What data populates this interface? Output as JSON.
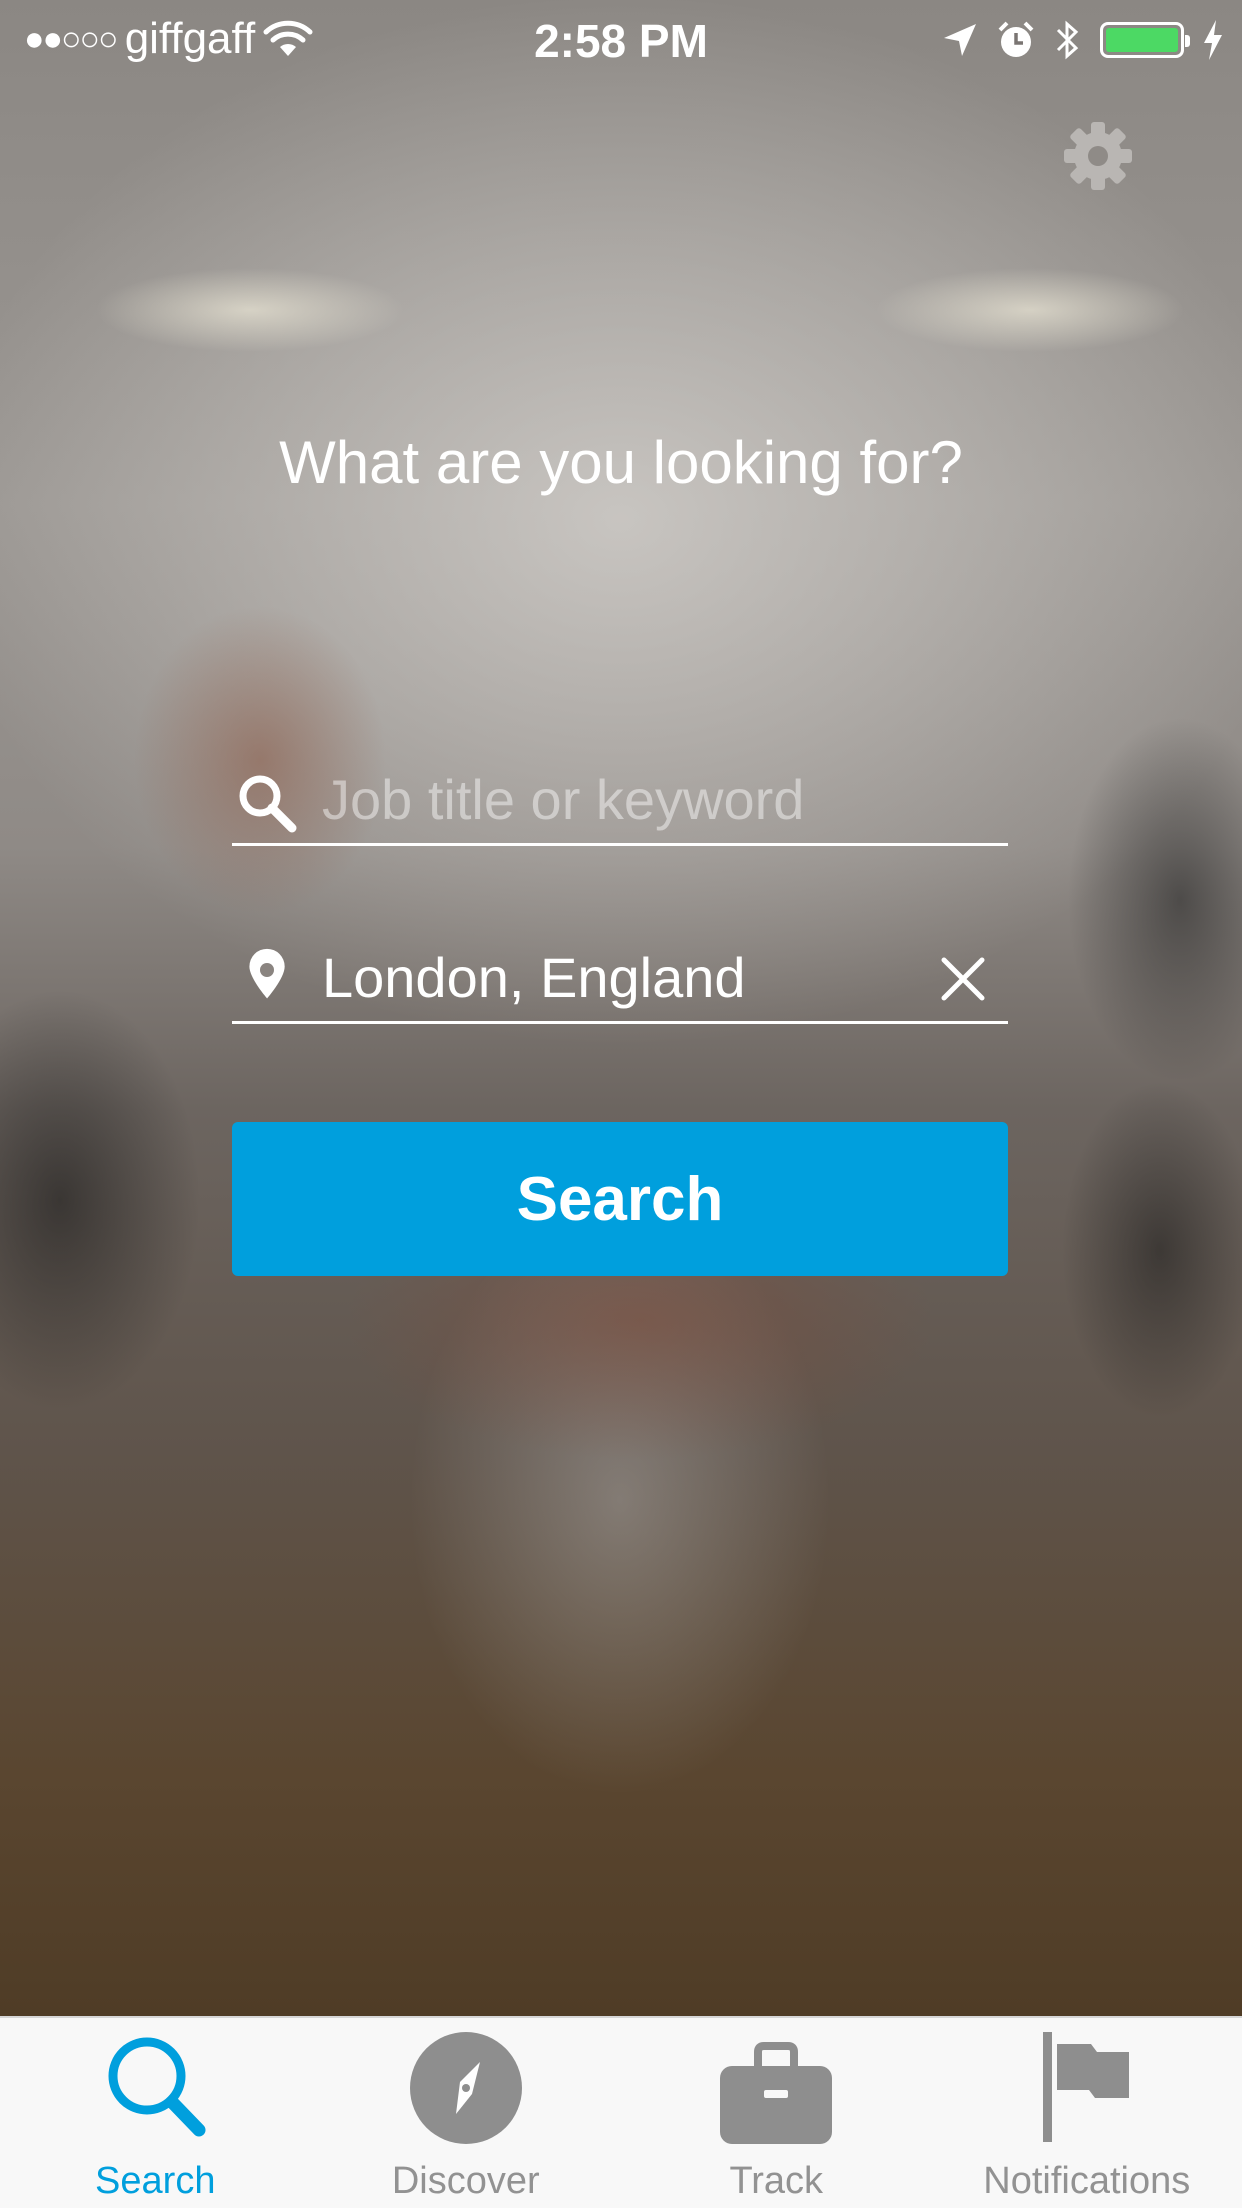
{
  "status_bar": {
    "signal_dots": "●●○○○",
    "carrier": "giffgaff",
    "time": "2:58 PM",
    "battery_color": "#4cd964"
  },
  "settings": {
    "icon": "gear-icon"
  },
  "heading": "What are you looking for?",
  "keyword_field": {
    "placeholder": "Job title or keyword",
    "value": "",
    "icon": "search-icon"
  },
  "location_field": {
    "value": "London, England",
    "icon": "location-pin-icon",
    "clear_icon": "close-icon"
  },
  "search_button": {
    "label": "Search",
    "color": "#009fdd"
  },
  "tabs": [
    {
      "label": "Search",
      "icon": "search-icon",
      "active": true
    },
    {
      "label": "Discover",
      "icon": "compass-icon",
      "active": false
    },
    {
      "label": "Track",
      "icon": "briefcase-icon",
      "active": false
    },
    {
      "label": "Notifications",
      "icon": "flag-icon",
      "active": false
    }
  ],
  "accent_color": "#009fdd"
}
